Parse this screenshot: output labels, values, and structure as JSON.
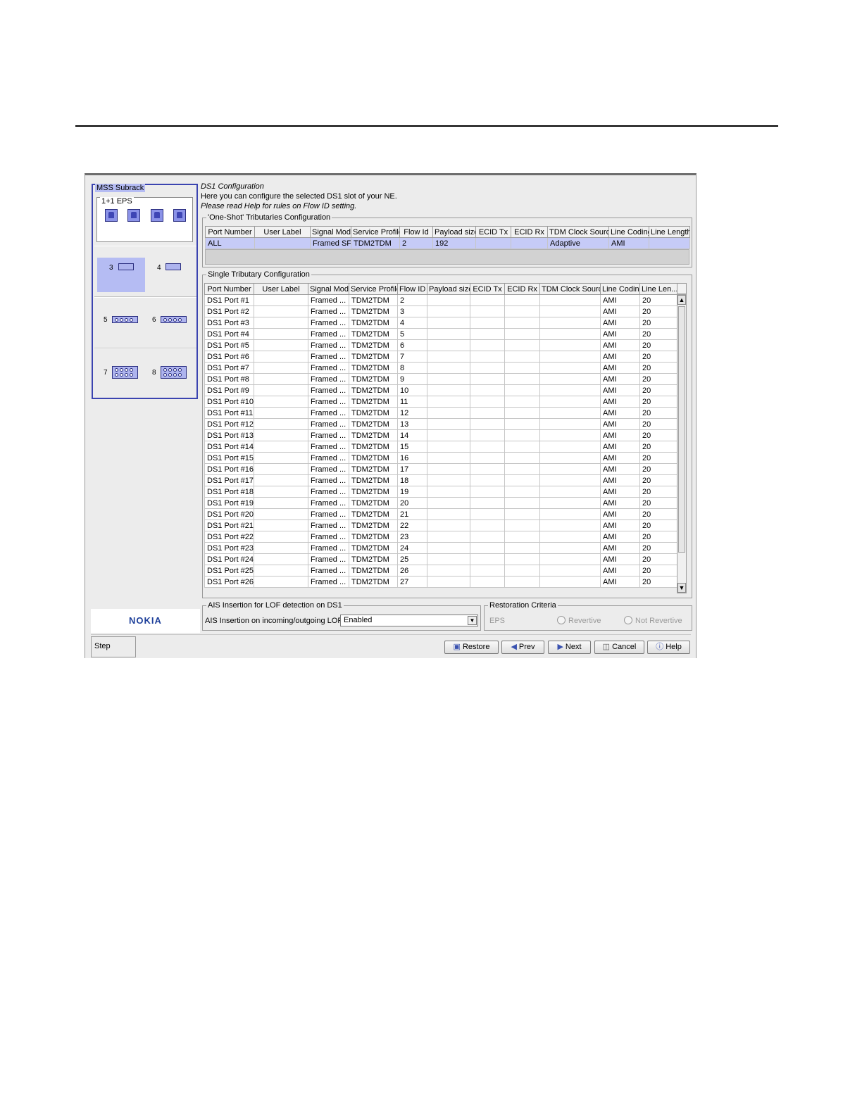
{
  "left_panel": {
    "title": "MSS Subrack",
    "eps_title": "1+1 EPS",
    "slots": [
      "3",
      "4",
      "5",
      "6",
      "7",
      "8"
    ]
  },
  "header": {
    "title": "DS1 Configuration",
    "subtitle": "Here you can configure the selected DS1 slot of your NE.",
    "help_note": "Please read Help for rules on Flow ID setting."
  },
  "one_shot": {
    "title": "'One-Shot' Tributaries Configuration",
    "columns": [
      "Port Number",
      "User Label",
      "Signal Mode",
      "Service Profile",
      "Flow Id",
      "Payload size",
      "ECID Tx",
      "ECID Rx",
      "TDM Clock Source",
      "Line Coding",
      "Line Length"
    ],
    "row": [
      "ALL",
      "",
      "Framed SF",
      "TDM2TDM",
      "2",
      "192",
      "",
      "",
      "Adaptive",
      "AMI",
      ""
    ]
  },
  "single": {
    "title": "Single Tributary Configuration",
    "columns": [
      "Port Number",
      "User Label",
      "Signal Mode",
      "Service Profile",
      "Flow ID",
      "Payload size",
      "ECID Tx",
      "ECID Rx",
      "TDM Clock Source",
      "Line Coding",
      "Line Len..."
    ],
    "rows": [
      [
        "DS1 Port #1",
        "",
        "Framed ...",
        "TDM2TDM",
        "2",
        "",
        "",
        "",
        "",
        "AMI",
        "20"
      ],
      [
        "DS1 Port #2",
        "",
        "Framed ...",
        "TDM2TDM",
        "3",
        "",
        "",
        "",
        "",
        "AMI",
        "20"
      ],
      [
        "DS1 Port #3",
        "",
        "Framed ...",
        "TDM2TDM",
        "4",
        "",
        "",
        "",
        "",
        "AMI",
        "20"
      ],
      [
        "DS1 Port #4",
        "",
        "Framed ...",
        "TDM2TDM",
        "5",
        "",
        "",
        "",
        "",
        "AMI",
        "20"
      ],
      [
        "DS1 Port #5",
        "",
        "Framed ...",
        "TDM2TDM",
        "6",
        "",
        "",
        "",
        "",
        "AMI",
        "20"
      ],
      [
        "DS1 Port #6",
        "",
        "Framed ...",
        "TDM2TDM",
        "7",
        "",
        "",
        "",
        "",
        "AMI",
        "20"
      ],
      [
        "DS1 Port #7",
        "",
        "Framed ...",
        "TDM2TDM",
        "8",
        "",
        "",
        "",
        "",
        "AMI",
        "20"
      ],
      [
        "DS1 Port #8",
        "",
        "Framed ...",
        "TDM2TDM",
        "9",
        "",
        "",
        "",
        "",
        "AMI",
        "20"
      ],
      [
        "DS1 Port #9",
        "",
        "Framed ...",
        "TDM2TDM",
        "10",
        "",
        "",
        "",
        "",
        "AMI",
        "20"
      ],
      [
        "DS1 Port #10",
        "",
        "Framed ...",
        "TDM2TDM",
        "11",
        "",
        "",
        "",
        "",
        "AMI",
        "20"
      ],
      [
        "DS1 Port #11",
        "",
        "Framed ...",
        "TDM2TDM",
        "12",
        "",
        "",
        "",
        "",
        "AMI",
        "20"
      ],
      [
        "DS1 Port #12",
        "",
        "Framed ...",
        "TDM2TDM",
        "13",
        "",
        "",
        "",
        "",
        "AMI",
        "20"
      ],
      [
        "DS1 Port #13",
        "",
        "Framed ...",
        "TDM2TDM",
        "14",
        "",
        "",
        "",
        "",
        "AMI",
        "20"
      ],
      [
        "DS1 Port #14",
        "",
        "Framed ...",
        "TDM2TDM",
        "15",
        "",
        "",
        "",
        "",
        "AMI",
        "20"
      ],
      [
        "DS1 Port #15",
        "",
        "Framed ...",
        "TDM2TDM",
        "16",
        "",
        "",
        "",
        "",
        "AMI",
        "20"
      ],
      [
        "DS1 Port #16",
        "",
        "Framed ...",
        "TDM2TDM",
        "17",
        "",
        "",
        "",
        "",
        "AMI",
        "20"
      ],
      [
        "DS1 Port #17",
        "",
        "Framed ...",
        "TDM2TDM",
        "18",
        "",
        "",
        "",
        "",
        "AMI",
        "20"
      ],
      [
        "DS1 Port #18",
        "",
        "Framed ...",
        "TDM2TDM",
        "19",
        "",
        "",
        "",
        "",
        "AMI",
        "20"
      ],
      [
        "DS1 Port #19",
        "",
        "Framed ...",
        "TDM2TDM",
        "20",
        "",
        "",
        "",
        "",
        "AMI",
        "20"
      ],
      [
        "DS1 Port #20",
        "",
        "Framed ...",
        "TDM2TDM",
        "21",
        "",
        "",
        "",
        "",
        "AMI",
        "20"
      ],
      [
        "DS1 Port #21",
        "",
        "Framed ...",
        "TDM2TDM",
        "22",
        "",
        "",
        "",
        "",
        "AMI",
        "20"
      ],
      [
        "DS1 Port #22",
        "",
        "Framed ...",
        "TDM2TDM",
        "23",
        "",
        "",
        "",
        "",
        "AMI",
        "20"
      ],
      [
        "DS1 Port #23",
        "",
        "Framed ...",
        "TDM2TDM",
        "24",
        "",
        "",
        "",
        "",
        "AMI",
        "20"
      ],
      [
        "DS1 Port #24",
        "",
        "Framed ...",
        "TDM2TDM",
        "25",
        "",
        "",
        "",
        "",
        "AMI",
        "20"
      ],
      [
        "DS1 Port #25",
        "",
        "Framed ...",
        "TDM2TDM",
        "26",
        "",
        "",
        "",
        "",
        "AMI",
        "20"
      ],
      [
        "DS1 Port #26",
        "",
        "Framed ...",
        "TDM2TDM",
        "27",
        "",
        "",
        "",
        "",
        "AMI",
        "20"
      ]
    ]
  },
  "ais": {
    "title": "AIS Insertion for LOF detection on DS1",
    "label": "AIS Insertion on incoming/outgoing LOF",
    "value": "Enabled"
  },
  "restoration": {
    "title": "Restoration Criteria",
    "label": "EPS",
    "option1": "Revertive",
    "option2": "Not Revertive"
  },
  "logo": "NOKIA",
  "footer": {
    "step": "Step",
    "buttons": {
      "restore": "Restore",
      "prev": "Prev",
      "next": "Next",
      "cancel": "Cancel",
      "help": "Help"
    }
  }
}
